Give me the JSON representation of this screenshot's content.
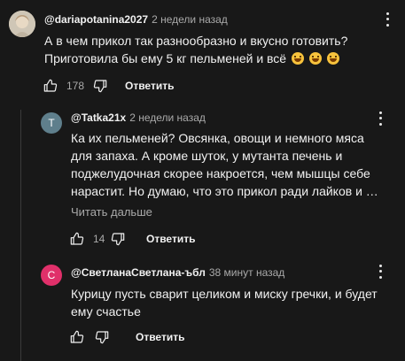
{
  "comments": [
    {
      "author": "@dariapotanina2027",
      "time": "2 недели назад",
      "text_lines": [
        "А в чем прикол так разнообразно и вкусно готовить?",
        "Приготовила бы ему 5 кг пельменей и всё"
      ],
      "likes": "178",
      "reply_label": "Ответить"
    },
    {
      "author": "@Tatka21x",
      "time": "2 недели назад",
      "avatar_letter": "T",
      "text_lines": [
        "Ка их пельменей? Овсянка, овощи и немного мяса",
        "для запаха. А кроме шуток, у мутанта печень и",
        "поджелудочная скорее накроется, чем мышцы себе",
        "нарастит. Но думаю, что это прикол ради лайков и …"
      ],
      "read_more": "Читать дальше",
      "likes": "14",
      "reply_label": "Ответить"
    },
    {
      "author": "@СветланаСветлана-ъбл",
      "time": "38 минут назад",
      "avatar_letter": "С",
      "text_lines": [
        "Курицу пусть сварит целиком и миску гречки, и будет",
        "ему счастье"
      ],
      "likes": "",
      "reply_label": "Ответить"
    }
  ],
  "icons": {
    "like": "thumb-up-icon",
    "dislike": "thumb-down-icon",
    "menu": "more-vert-icon",
    "emoji": "grinning-sweat-emoji"
  },
  "colors": {
    "background": "#181818",
    "avatar_tatka": "#5f7f8c",
    "avatar_svetlana": "#e0306a"
  }
}
